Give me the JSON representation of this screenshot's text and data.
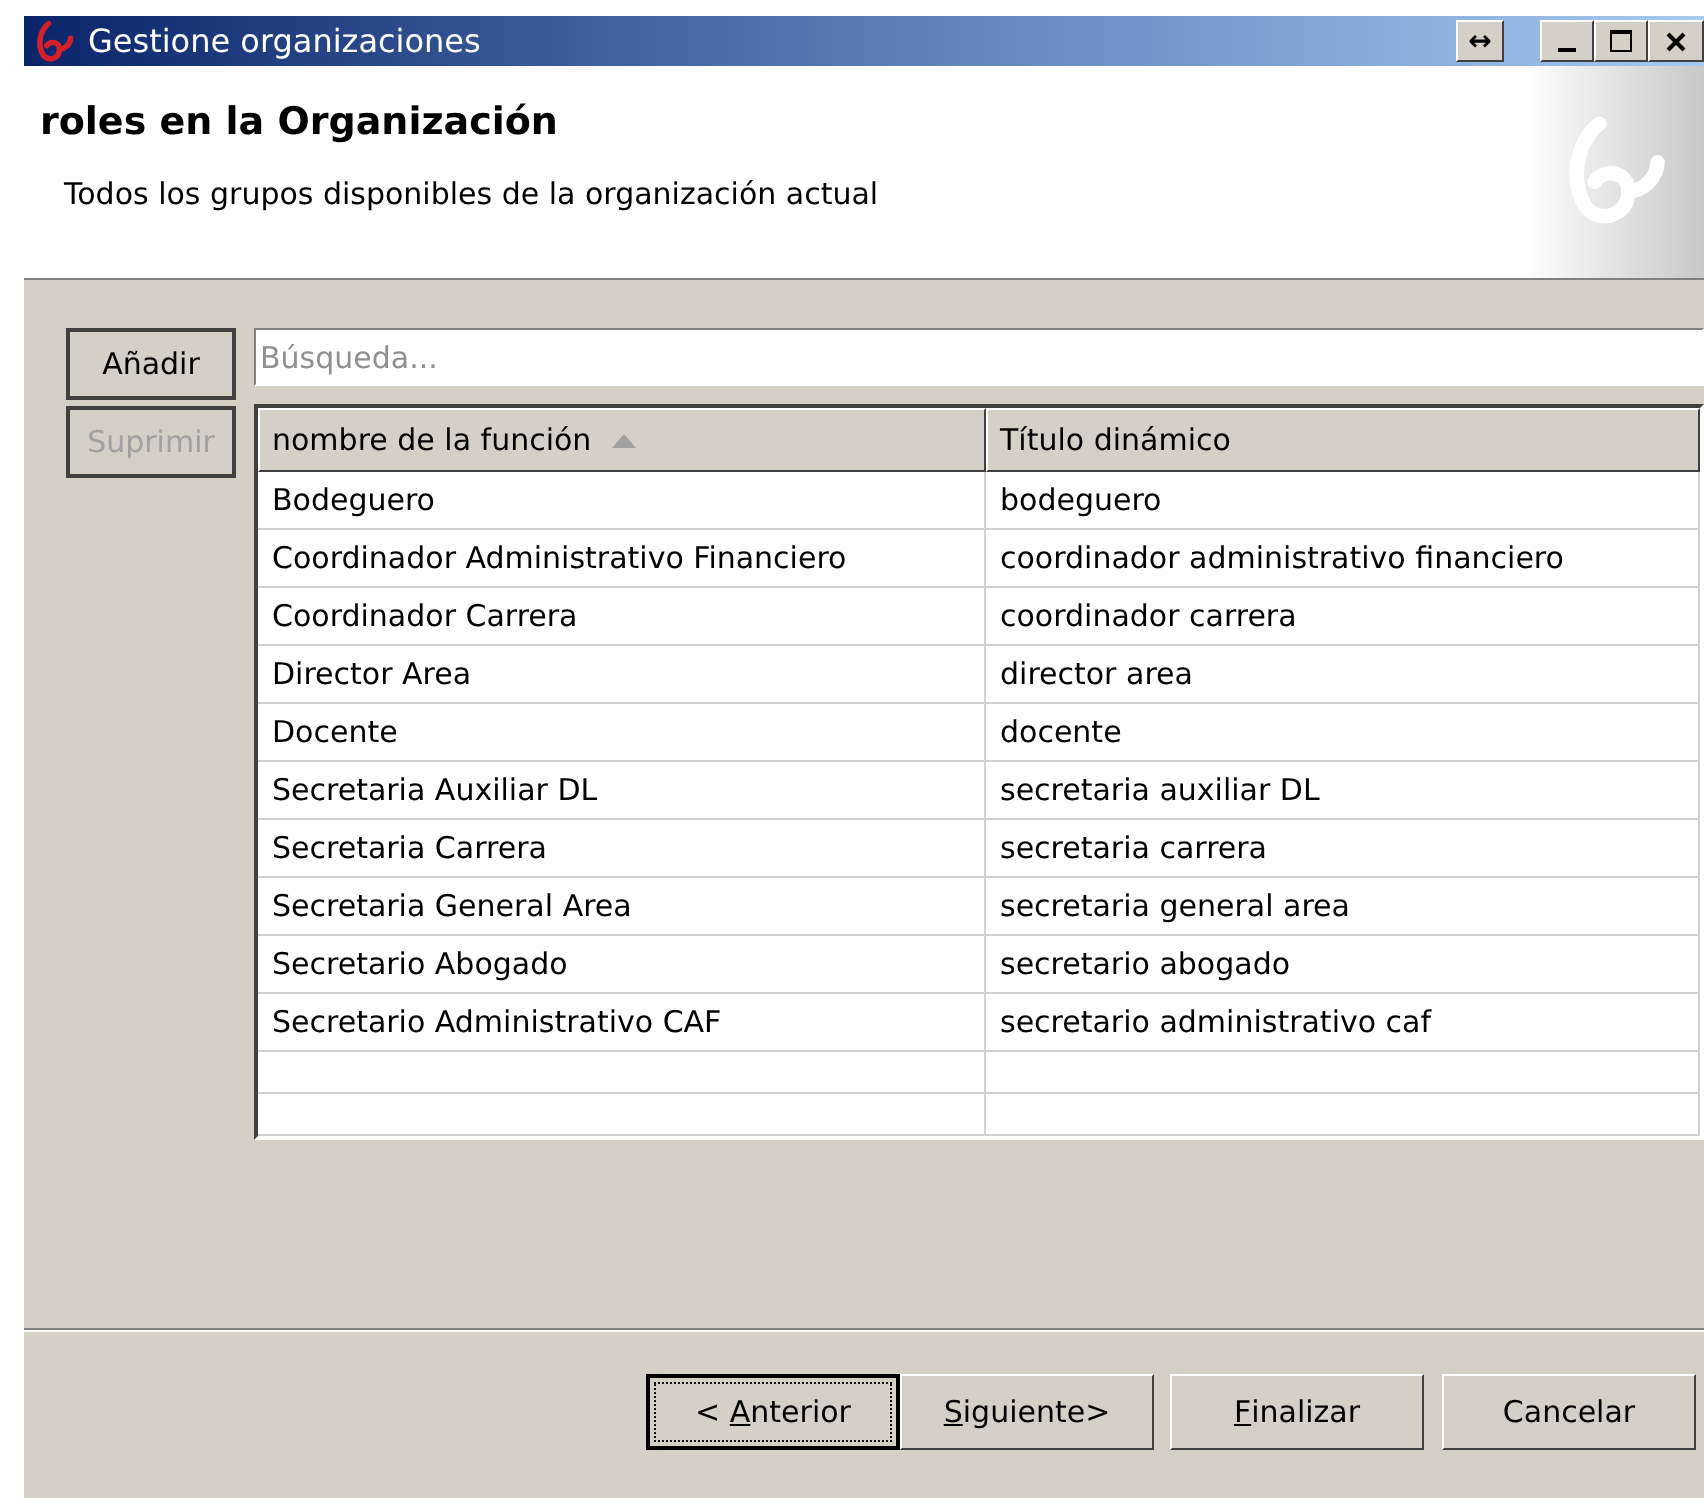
{
  "window": {
    "title": "Gestione organizaciones",
    "resize_glyph": "↔"
  },
  "header": {
    "title": "roles en la Organización",
    "subtitle": "Todos los grupos disponibles de la organización actual"
  },
  "side_buttons": [
    {
      "label": "Añadir",
      "disabled": false
    },
    {
      "label": "Suprimir",
      "disabled": true
    }
  ],
  "search": {
    "placeholder": "Búsqueda..."
  },
  "table": {
    "columns": [
      {
        "label": "nombre de la función",
        "sorted": true
      },
      {
        "label": "Título dinámico",
        "sorted": false
      }
    ],
    "rows": [
      [
        "Bodeguero",
        "bodeguero"
      ],
      [
        "Coordinador Administrativo Financiero",
        "coordinador administrativo financiero"
      ],
      [
        "Coordinador Carrera",
        "coordinador carrera"
      ],
      [
        "Director Area",
        "director area"
      ],
      [
        "Docente",
        "docente"
      ],
      [
        "Secretaria Auxiliar DL",
        "secretaria auxiliar DL"
      ],
      [
        "Secretaria Carrera",
        "secretaria carrera"
      ],
      [
        "Secretaria General Area",
        "secretaria general area"
      ],
      [
        "Secretario Abogado",
        "secretario abogado"
      ],
      [
        "Secretario Administrativo CAF",
        "secretario administrativo caf"
      ]
    ]
  },
  "footer_buttons": [
    {
      "prefix": "< ",
      "mnemonic": "A",
      "rest": "nterior",
      "default": true
    },
    {
      "mnemonic": "S",
      "rest": "iguiente>",
      "default": false
    },
    {
      "mnemonic": "F",
      "rest": "inalizar",
      "default": false
    },
    {
      "prefix": "Cancelar",
      "default": false
    }
  ]
}
